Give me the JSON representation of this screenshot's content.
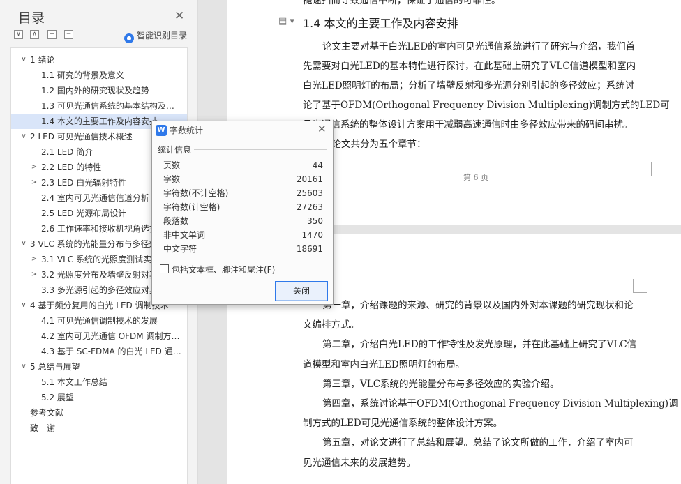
{
  "sidebar": {
    "title": "目录",
    "smart_toc_label": "智能识别目录",
    "items": [
      {
        "label": "1  绪论",
        "arrow": "∨"
      },
      {
        "label": "1.1  研究的背景及意义",
        "arrow": ""
      },
      {
        "label": "1.2  国内外的研究现状及趋势",
        "arrow": ""
      },
      {
        "label": "1.3  可见光通信系统的基本结构及…",
        "arrow": ""
      },
      {
        "label": "1.4  本文的主要工作及内容安排",
        "arrow": "",
        "selected": true
      },
      {
        "label": "2  LED 可见光通信技术概述",
        "arrow": "∨"
      },
      {
        "label": "2.1  LED 简介",
        "arrow": ""
      },
      {
        "label": "2.2  LED 的特性",
        "arrow": ">"
      },
      {
        "label": "2.3  LED 白光辐射特性",
        "arrow": ">"
      },
      {
        "label": "2.4  室内可见光通信信道分析",
        "arrow": ""
      },
      {
        "label": "2.5  LED 光源布局设计",
        "arrow": ""
      },
      {
        "label": "2.6  工作速率和接收机视角选择",
        "arrow": ""
      },
      {
        "label": "3  VLC 系统的光能量分布与多径效应",
        "arrow": "∨"
      },
      {
        "label": "3.1  VLC 系统的光照度测试实验",
        "arrow": ">"
      },
      {
        "label": "3.2  光照度分布及墙壁反射对其",
        "arrow": ">"
      },
      {
        "label": "3.3  多光源引起的多径效应对其",
        "arrow": ""
      },
      {
        "label": "4  基于频分复用的白光 LED 调制技术",
        "arrow": "∨"
      },
      {
        "label": "4.1  可见光通信调制技术的发展",
        "arrow": ""
      },
      {
        "label": "4.2  室内可见光通信 OFDM 调制方…",
        "arrow": ""
      },
      {
        "label": "4.3  基于 SC-FDMA 的白光 LED 通…",
        "arrow": ""
      },
      {
        "label": "5  总结与展望",
        "arrow": "∨"
      },
      {
        "label": "5.1  本文工作总结",
        "arrow": ""
      },
      {
        "label": "5.2  展望",
        "arrow": ""
      },
      {
        "label": "参考文献",
        "arrow": ""
      },
      {
        "label": "致　谢",
        "arrow": ""
      }
    ]
  },
  "doc": {
    "top_cut": "褪速扫而导致通信中断，保证了通信的可靠性。",
    "heading": "1.4  本文的主要工作及内容安排",
    "p1": [
      "论文主要对基于白光LED的室内可见光通信系统进行了研究与介绍，我们首",
      "先需要对白光LED的基本特性进行探讨，在此基础上研究了VLC信道模型和室内",
      "白光LED照明灯的布局；分析了墙壁反射和多光源分别引起的多径效应；系统讨",
      "论了基于OFDM(Orthogonal    Frequency Division Multiplexing)调制方式的LED可",
      "见光通信系统的整体设计方案用于减弱高速通信时由多径效应带来的码间串扰。",
      "本论文共分为五个章节："
    ],
    "footer": "第 6 页",
    "p2": [
      "第一章，介绍课题的来源、研究的背景以及国内外对本课题的研究现状和论",
      "文编排方式。",
      "第二章，介绍白光LED的工作特性及发光原理，并在此基础上研究了VLC信",
      "道模型和室内白光LED照明灯的布局。",
      "第三章，VLC系统的光能量分布与多径效应的实验介绍。",
      "第四章，系统讨论基于OFDM(Orthogonal Frequency Division Multiplexing)调",
      "制方式的LED可见光通信系统的整体设计方案。",
      "第五章，对论文进行了总结和展望。总结了论文所做的工作，介绍了室内可",
      "见光通信未来的发展趋势。"
    ]
  },
  "dialog": {
    "title": "字数统计",
    "section_label": "统计信息",
    "stats": [
      {
        "label": "页数",
        "value": "44"
      },
      {
        "label": "字数",
        "value": "20161"
      },
      {
        "label": "字符数(不计空格)",
        "value": "25603"
      },
      {
        "label": "字符数(计空格)",
        "value": "27263"
      },
      {
        "label": "段落数",
        "value": "350"
      },
      {
        "label": "非中文单词",
        "value": "1470"
      },
      {
        "label": "中文字符",
        "value": "18691"
      }
    ],
    "checkbox_label": "包括文本框、脚注和尾注(F)",
    "close_button": "关闭"
  }
}
